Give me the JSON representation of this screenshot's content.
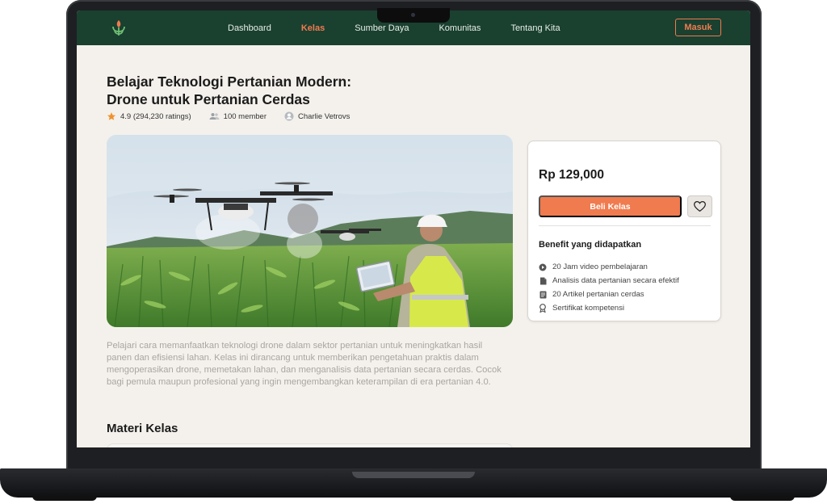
{
  "nav": {
    "links": [
      {
        "label": "Dashboard",
        "active": false
      },
      {
        "label": "Kelas",
        "active": true
      },
      {
        "label": "Sumber Daya",
        "active": false
      },
      {
        "label": "Komunitas",
        "active": false
      },
      {
        "label": "Tentang Kita",
        "active": false
      }
    ],
    "login_label": "Masuk"
  },
  "course": {
    "title_line1": "Belajar Teknologi Pertanian Modern:",
    "title_line2": "Drone untuk Pertanian Cerdas",
    "rating": "4.9 (294,230 ratings)",
    "members": "100 member",
    "author": "Charlie Vetrovs",
    "description": "Pelajari cara memanfaatkan teknologi drone dalam sektor pertanian untuk meningkatkan hasil panen dan efisiensi lahan. Kelas ini dirancang untuk memberikan pengetahuan praktis dalam mengoperasikan drone, memetakan lahan, dan menganalisis data pertanian secara cerdas. Cocok bagi pemula maupun profesional yang ingin mengembangkan keterampilan di era pertanian 4.0.",
    "section_title": "Materi Kelas"
  },
  "purchase": {
    "price": "Rp 129,000",
    "buy_label": "Beli Kelas",
    "benefit_title": "Benefit yang didapatkan",
    "benefits": [
      {
        "icon": "play-icon",
        "label": "20 Jam video pembelajaran"
      },
      {
        "icon": "document-icon",
        "label": "Analisis data pertanian secara efektif"
      },
      {
        "icon": "article-icon",
        "label": "20 Artikel pertanian cerdas"
      },
      {
        "icon": "certificate-icon",
        "label": "Sertifikat kompetensi"
      }
    ]
  },
  "colors": {
    "nav_bg": "#1a4030",
    "accent": "#f07b4f",
    "page_bg": "#f4f1ec"
  }
}
